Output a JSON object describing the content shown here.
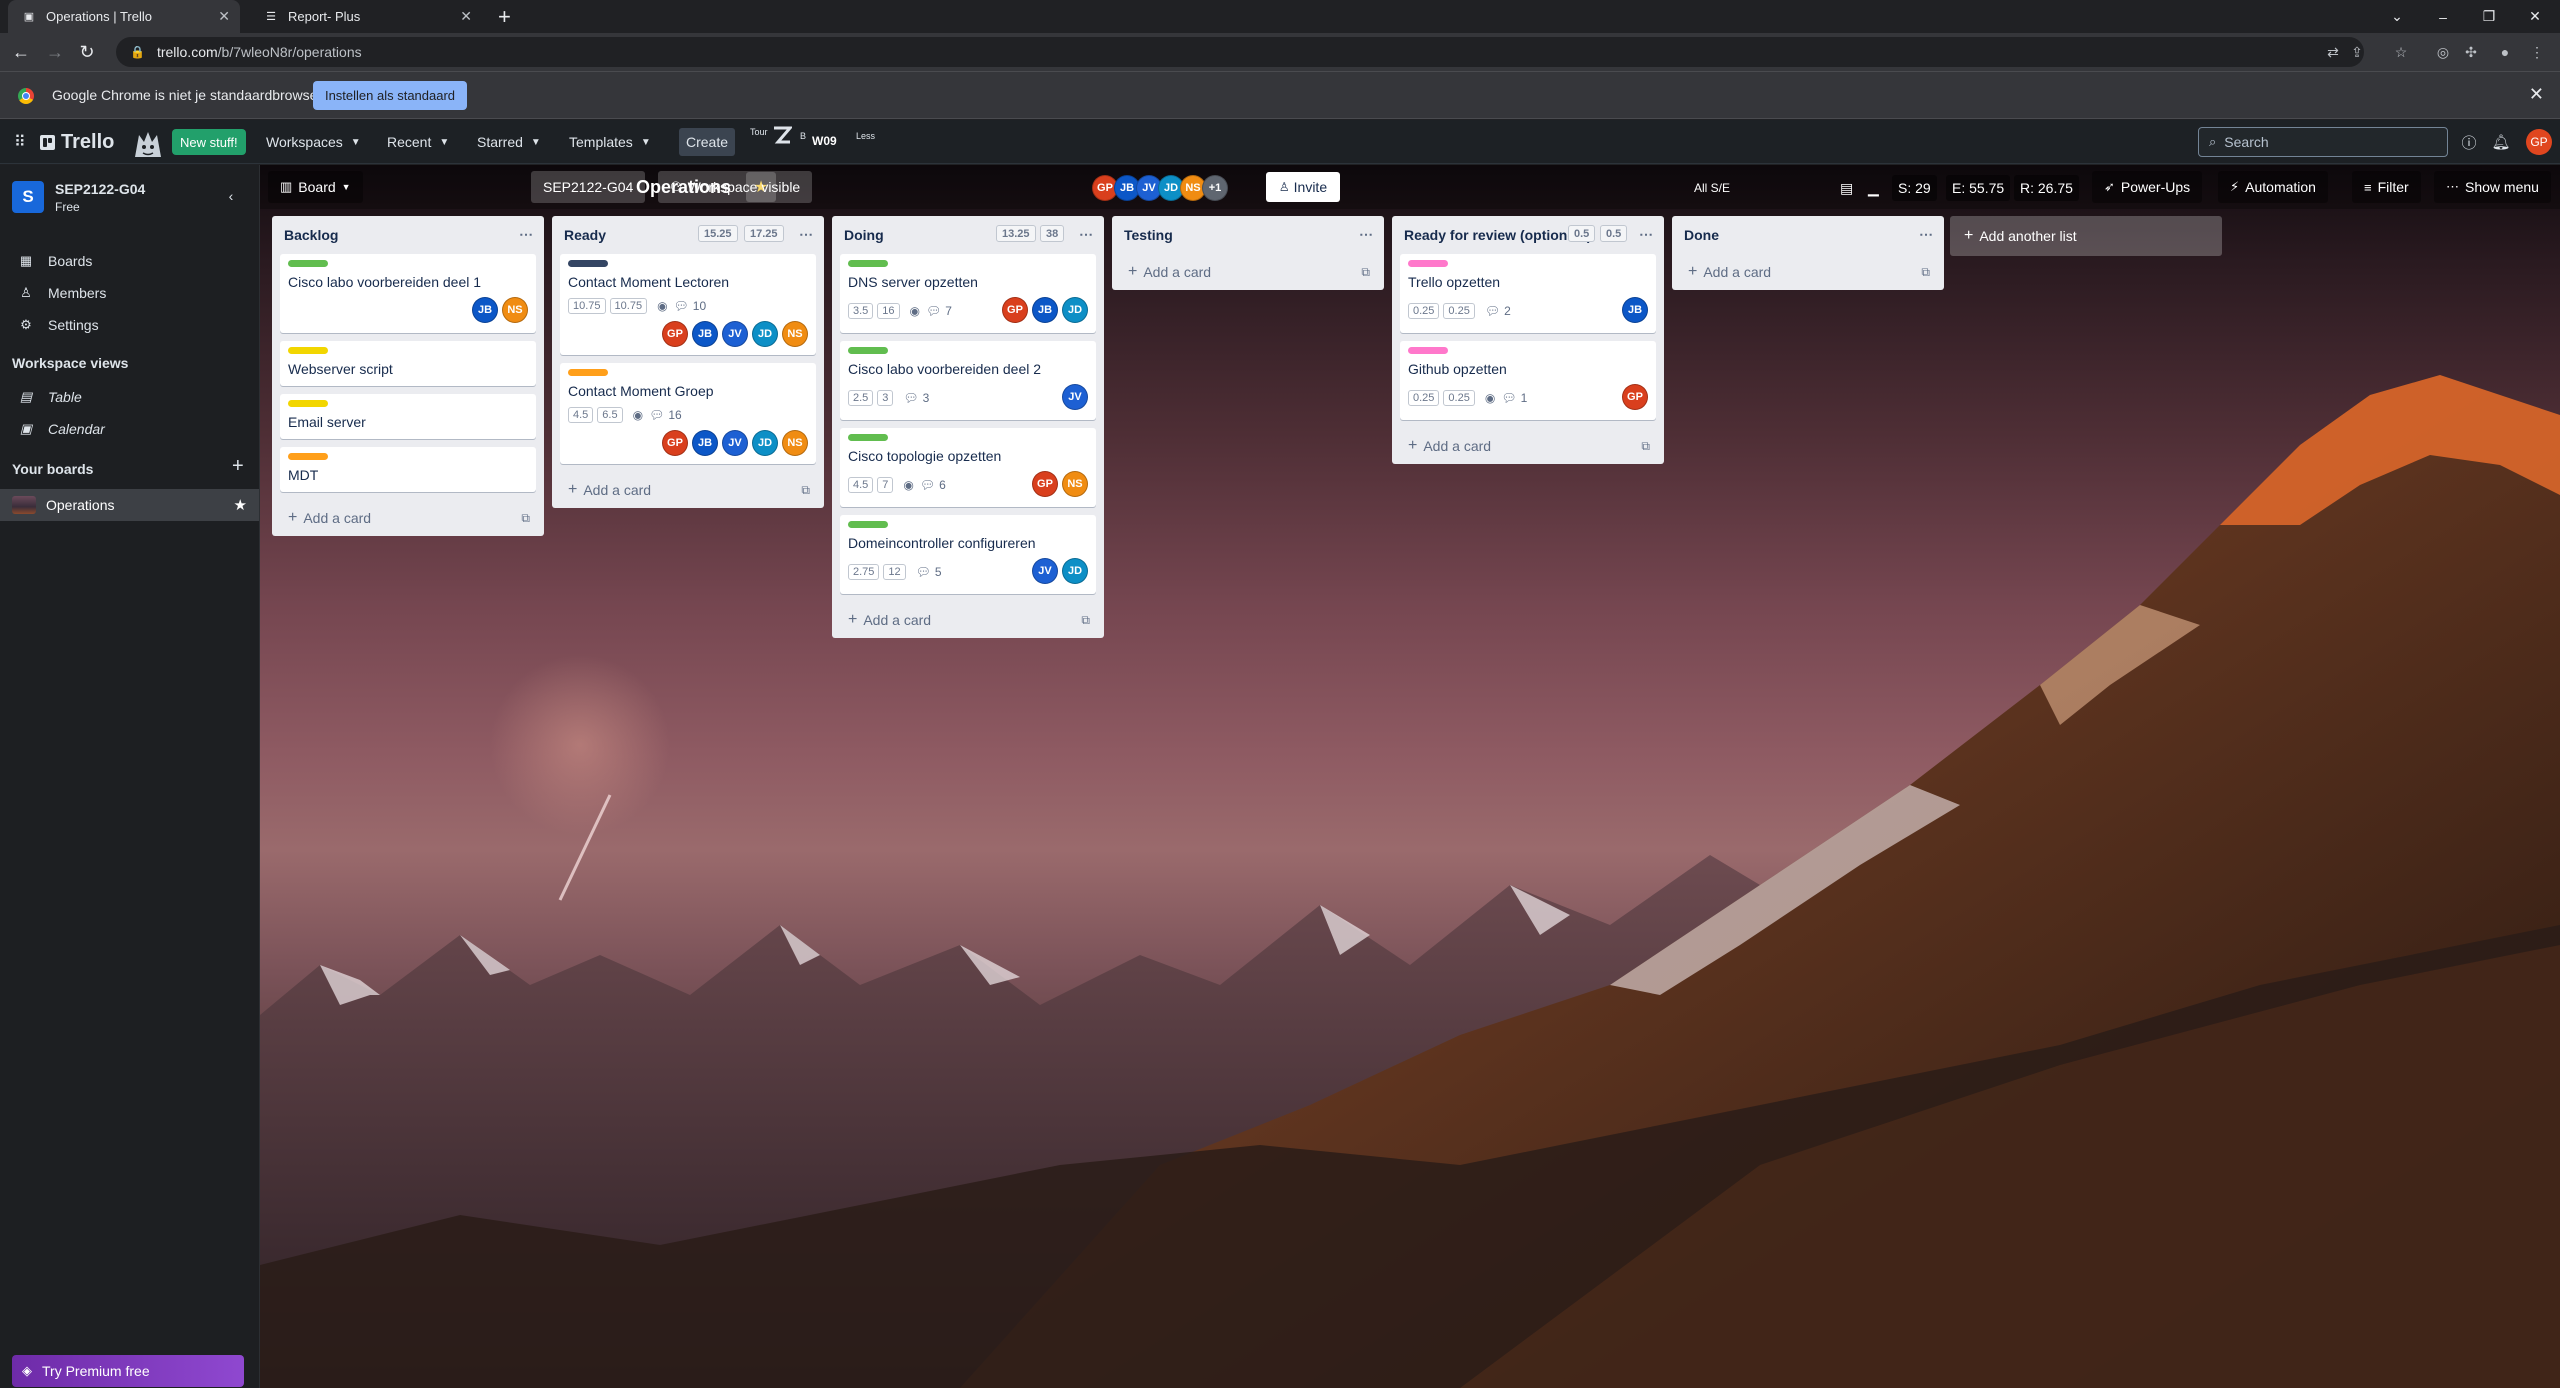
{
  "browser": {
    "tabs": [
      {
        "title": "Operations | Trello",
        "icon": "trello-icon",
        "active": true
      },
      {
        "title": "Report- Plus",
        "icon": "report-icon",
        "active": false
      }
    ],
    "url_host": "trello.com",
    "url_path": "/b/7wleoN8r/operations",
    "infobar": {
      "message": "Google Chrome is niet je standaardbrowser",
      "button": "Instellen als standaard"
    }
  },
  "header": {
    "logo": "Trello",
    "new_stuff": "New stuff!",
    "menus": [
      "Workspaces",
      "Recent",
      "Starred",
      "Templates"
    ],
    "create": "Create",
    "tour": "Tour",
    "ext_b": "B",
    "week": "W09",
    "less": "Less",
    "search_placeholder": "Search",
    "user_initials": "GP"
  },
  "sidebar": {
    "workspace_initial": "S",
    "workspace_name": "SEP2122-G04",
    "workspace_plan": "Free",
    "items": [
      {
        "label": "Boards",
        "icon": "board-icon"
      },
      {
        "label": "Members",
        "icon": "person-icon"
      },
      {
        "label": "Settings",
        "icon": "gear-icon"
      }
    ],
    "views_heading": "Workspace views",
    "views": [
      {
        "label": "Table",
        "icon": "table-icon"
      },
      {
        "label": "Calendar",
        "icon": "calendar-icon"
      }
    ],
    "boards_heading": "Your boards",
    "boards": [
      {
        "label": "Operations"
      }
    ],
    "premium": "Try Premium free"
  },
  "board": {
    "view": "Board",
    "title": "Operations",
    "workspace": "SEP2122-G04",
    "visibility": "Workspace visible",
    "members": [
      "GP",
      "JB",
      "JV",
      "JD",
      "NS"
    ],
    "more_members": "+1",
    "invite": "Invite",
    "all_se": "All S/E",
    "stat_s": "S: 29",
    "stat_e": "E: 55.75",
    "stat_r": "R: 26.75",
    "powerups": "Power-Ups",
    "automation": "Automation",
    "filter": "Filter",
    "show_menu": "Show menu",
    "add_list": "Add another list",
    "add_card": "Add a card"
  },
  "lists": [
    {
      "title": "Backlog",
      "badges": [],
      "cards": [
        {
          "label_color": "#61bd4f",
          "title": "Cisco labo voorbereiden deel 1",
          "members": [
            "JB",
            "NS"
          ]
        },
        {
          "label_color": "#f2d600",
          "title": "Webserver script",
          "members": []
        },
        {
          "label_color": "#f2d600",
          "title": "Email server",
          "members": []
        },
        {
          "label_color": "#ff9f1a",
          "title": "MDT",
          "members": []
        }
      ]
    },
    {
      "title": "Ready",
      "badges": [
        "15.25",
        "17.25"
      ],
      "cards": [
        {
          "label_color": "#344563",
          "title": "Contact Moment Lectoren",
          "points": [
            "10.75",
            "10.75"
          ],
          "watch": true,
          "comments": "10",
          "members": [
            "GP",
            "JB",
            "JV",
            "JD",
            "NS"
          ]
        },
        {
          "label_color": "#ff9f1a",
          "title": "Contact Moment Groep",
          "points": [
            "4.5",
            "6.5"
          ],
          "watch": true,
          "comments": "16",
          "members": [
            "GP",
            "JB",
            "JV",
            "JD",
            "NS"
          ]
        }
      ]
    },
    {
      "title": "Doing",
      "badges": [
        "13.25",
        "38"
      ],
      "cards": [
        {
          "label_color": "#61bd4f",
          "title": "DNS server opzetten",
          "points": [
            "3.5",
            "16"
          ],
          "watch": true,
          "comments": "7",
          "members": [
            "GP",
            "JB",
            "JD"
          ]
        },
        {
          "label_color": "#61bd4f",
          "title": "Cisco labo voorbereiden deel 2",
          "points": [
            "2.5",
            "3"
          ],
          "watch": false,
          "comments": "3",
          "members": [
            "JV"
          ]
        },
        {
          "label_color": "#61bd4f",
          "title": "Cisco topologie opzetten",
          "points": [
            "4.5",
            "7"
          ],
          "watch": true,
          "comments": "6",
          "members": [
            "GP",
            "NS"
          ]
        },
        {
          "label_color": "#61bd4f",
          "title": "Domeincontroller configureren",
          "points": [
            "2.75",
            "12"
          ],
          "watch": false,
          "comments": "5",
          "members": [
            "JV",
            "JD"
          ]
        }
      ]
    },
    {
      "title": "Testing",
      "badges": [],
      "cards": []
    },
    {
      "title": "Ready for review (optioneel)",
      "badges": [
        "0.5",
        "0.5"
      ],
      "cards": [
        {
          "label_color": "#ff78cb",
          "title": "Trello opzetten",
          "points": [
            "0.25",
            "0.25"
          ],
          "watch": false,
          "comments": "2",
          "members": [
            "JB"
          ]
        },
        {
          "label_color": "#ff78cb",
          "title": "Github opzetten",
          "points": [
            "0.25",
            "0.25"
          ],
          "watch": true,
          "comments": "1",
          "members": [
            "GP"
          ]
        }
      ]
    },
    {
      "title": "Done",
      "badges": [],
      "cards": []
    }
  ]
}
